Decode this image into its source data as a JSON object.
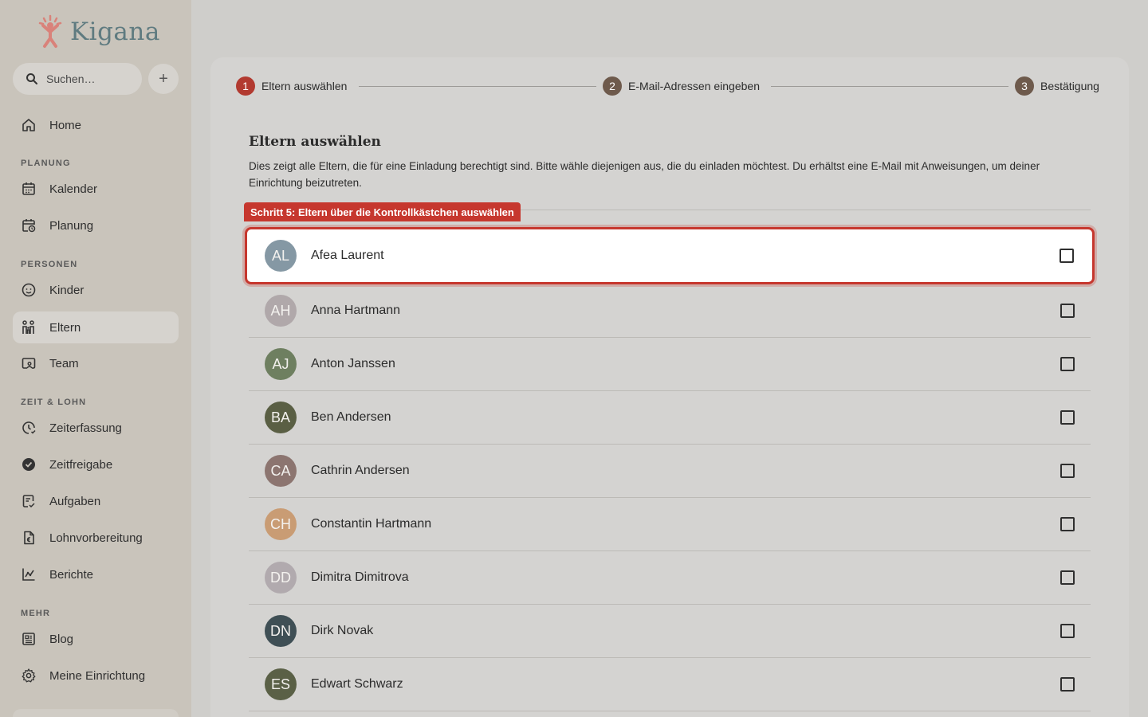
{
  "app": {
    "name": "Kigana"
  },
  "sidebar": {
    "search_placeholder": "Suchen…",
    "home": "Home",
    "sections": {
      "planung": "PLANUNG",
      "personen": "PERSONEN",
      "zeit": "ZEIT & LOHN",
      "mehr": "MEHR"
    },
    "items": {
      "kalender": "Kalender",
      "planung": "Planung",
      "kinder": "Kinder",
      "eltern": "Eltern",
      "team": "Team",
      "zeiterfassung": "Zeiterfassung",
      "zeitfreigabe": "Zeitfreigabe",
      "aufgaben": "Aufgaben",
      "lohnvorbereitung": "Lohnvorbereitung",
      "berichte": "Berichte",
      "blog": "Blog",
      "einrichtung": "Meine Einrichtung"
    }
  },
  "stepper": {
    "steps": [
      {
        "num": "1",
        "label": "Eltern auswählen"
      },
      {
        "num": "2",
        "label": "E-Mail-Adressen eingeben"
      },
      {
        "num": "3",
        "label": "Bestätigung"
      }
    ]
  },
  "main": {
    "title": "Eltern auswählen",
    "description": "Dies zeigt alle Eltern, die für eine Einladung berechtigt sind. Bitte wähle diejenigen aus, die du einladen möchtest. Du erhältst eine E-Mail mit Anweisungen, um deiner Einrichtung beizutreten.",
    "hint": "Schritt 5: Eltern über die Kontrollkästchen auswählen",
    "parents": [
      {
        "initials": "AL",
        "name": "Afea Laurent",
        "color": "#8598a4"
      },
      {
        "initials": "AH",
        "name": "Anna Hartmann",
        "color": "#b0a8aa"
      },
      {
        "initials": "AJ",
        "name": "Anton Janssen",
        "color": "#6e7f60"
      },
      {
        "initials": "BA",
        "name": "Ben Andersen",
        "color": "#5a5f44"
      },
      {
        "initials": "CA",
        "name": "Cathrin Andersen",
        "color": "#8c7570"
      },
      {
        "initials": "CH",
        "name": "Constantin Hartmann",
        "color": "#c99c74"
      },
      {
        "initials": "DD",
        "name": "Dimitra Dimitrova",
        "color": "#b1aaae"
      },
      {
        "initials": "DN",
        "name": "Dirk Novak",
        "color": "#3f4f55"
      },
      {
        "initials": "ES",
        "name": "Edwart Schwarz",
        "color": "#5a6046"
      }
    ]
  }
}
